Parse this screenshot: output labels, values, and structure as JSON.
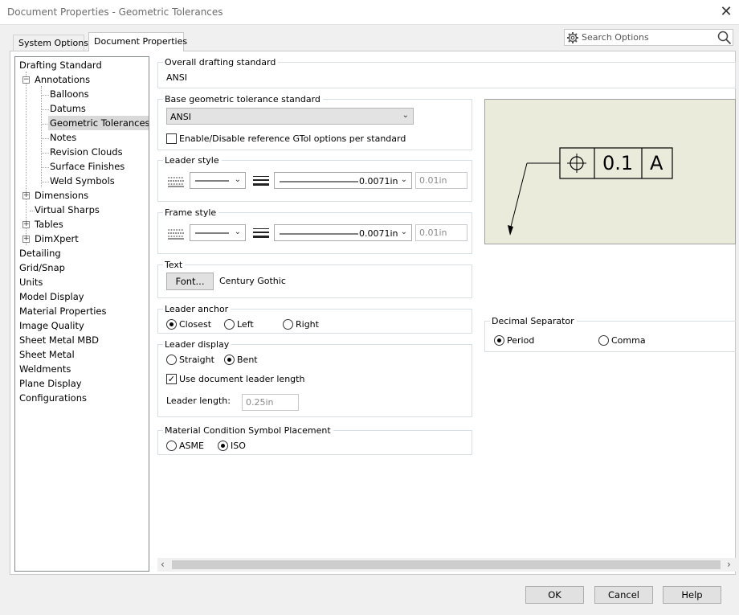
{
  "window": {
    "title": "Document Properties - Geometric Tolerances"
  },
  "tabs": [
    {
      "label": "System Options"
    },
    {
      "label": "Document Properties"
    }
  ],
  "search": {
    "placeholder": "Search Options"
  },
  "tree": {
    "items": [
      {
        "label": "Drafting Standard"
      },
      {
        "label": "Annotations"
      },
      {
        "label": "Balloons"
      },
      {
        "label": "Datums"
      },
      {
        "label": "Geometric Tolerances"
      },
      {
        "label": "Notes"
      },
      {
        "label": "Revision Clouds"
      },
      {
        "label": "Surface Finishes"
      },
      {
        "label": "Weld Symbols"
      },
      {
        "label": "Dimensions"
      },
      {
        "label": "Virtual Sharps"
      },
      {
        "label": "Tables"
      },
      {
        "label": "DimXpert"
      },
      {
        "label": "Detailing"
      },
      {
        "label": "Grid/Snap"
      },
      {
        "label": "Units"
      },
      {
        "label": "Model Display"
      },
      {
        "label": "Material Properties"
      },
      {
        "label": "Image Quality"
      },
      {
        "label": "Sheet Metal MBD"
      },
      {
        "label": "Sheet Metal"
      },
      {
        "label": "Weldments"
      },
      {
        "label": "Plane Display"
      },
      {
        "label": "Configurations"
      }
    ]
  },
  "overall": {
    "title": "Overall drafting standard",
    "value": "ANSI"
  },
  "base": {
    "title": "Base geometric tolerance standard",
    "value": "ANSI",
    "checkbox_label": "Enable/Disable reference GTol options per standard",
    "checked": false
  },
  "leader_style": {
    "title": "Leader style",
    "thickness": "0.0071in",
    "custom": "0.01in"
  },
  "frame_style": {
    "title": "Frame style",
    "thickness": "0.0071in",
    "custom": "0.01in"
  },
  "text": {
    "title": "Text",
    "font_button": "Font...",
    "font_name": "Century Gothic"
  },
  "leader_anchor": {
    "title": "Leader anchor",
    "options": [
      "Closest",
      "Left",
      "Right"
    ],
    "selected": "Closest"
  },
  "leader_display": {
    "title": "Leader display",
    "options": [
      "Straight",
      "Bent"
    ],
    "selected": "Bent",
    "checkbox_label": "Use document leader length",
    "checked": true,
    "length_label": "Leader length:",
    "length_value": "0.25in"
  },
  "mcs": {
    "title": "Material Condition Symbol Placement",
    "options": [
      "ASME",
      "ISO"
    ],
    "selected": "ISO"
  },
  "decimal": {
    "title": "Decimal Separator",
    "options": [
      "Period",
      "Comma"
    ],
    "selected": "Period"
  },
  "preview": {
    "tolerance": "0.1",
    "datum": "A"
  },
  "footer": {
    "ok": "OK",
    "cancel": "Cancel",
    "help": "Help"
  }
}
